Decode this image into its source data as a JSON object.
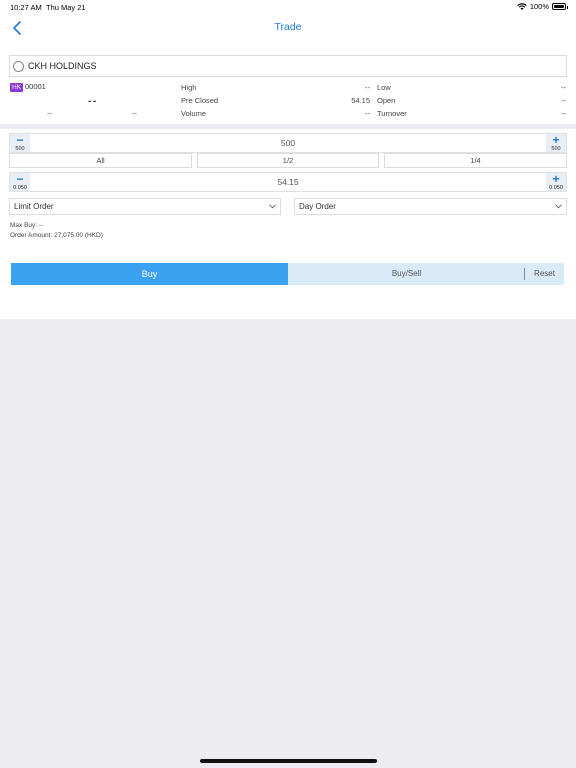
{
  "status_bar": {
    "time": "10:27 AM",
    "date": "Thu May 21",
    "battery": "100%"
  },
  "nav": {
    "title": "Trade"
  },
  "search": {
    "value": "CKH HOLDINGS"
  },
  "quote": {
    "market_badge": "HK",
    "code": "00001",
    "last": "--",
    "change": "--",
    "change_pct": "--",
    "high_label": "High",
    "high_value": "--",
    "pre_closed_label": "Pre Closed",
    "pre_closed_value": "54.15",
    "volume_label": "Volume",
    "volume_value": "--",
    "low_label": "Low",
    "low_value": "--",
    "open_label": "Open",
    "open_value": "--",
    "turnover_label": "Turnover",
    "turnover_value": "--"
  },
  "quantity": {
    "value": "500",
    "step": "500"
  },
  "fractions": [
    "All",
    "1/2",
    "1/4"
  ],
  "price": {
    "value": "54.15",
    "step": "0.050"
  },
  "order_type": {
    "selected": "Limit Order"
  },
  "validity": {
    "selected": "Day Order"
  },
  "info": {
    "max_buy_label": "Max Buy:",
    "max_buy_value": "--",
    "order_amount_label": "Order Amount:",
    "order_amount_value": "27,075.00 (HKD)"
  },
  "actions": {
    "buy": "Buy",
    "buy_sell": "Buy/Sell",
    "reset": "Reset"
  },
  "colors": {
    "accent": "#1e7ad6",
    "buy": "#3aa1f0",
    "badge": "#8c3ad9"
  }
}
